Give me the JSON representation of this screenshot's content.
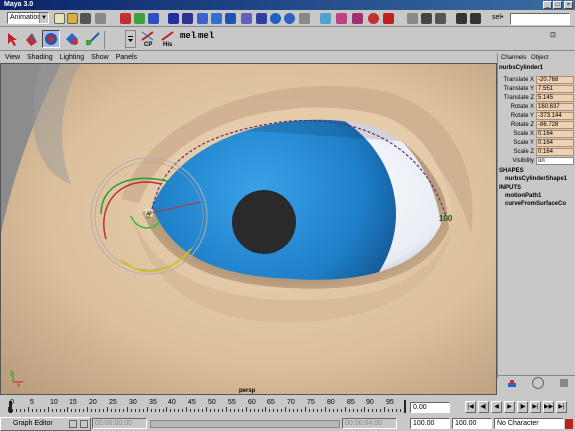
{
  "window": {
    "title": "Maya 3.0"
  },
  "status_line": {
    "menu_set": "Animation",
    "selection_label": "sel•",
    "selection_value": ""
  },
  "shelf": {
    "cp_label": "CP",
    "his_label": "His",
    "mel1": "mel",
    "mel2": "mel"
  },
  "panel_menu": [
    "View",
    "Shading",
    "Lighting",
    "Show",
    "Panels"
  ],
  "viewport": {
    "camera": "persp",
    "curve_start_label": "0",
    "curve_end_label": "100",
    "axis_x": "x",
    "axis_y": "y"
  },
  "channel_box": {
    "tabs": [
      "Channels",
      "Object"
    ],
    "object_name": "nurbsCylinder1",
    "channels": [
      {
        "label": "Translate X",
        "value": "-20.768"
      },
      {
        "label": "Translate Y",
        "value": "7.551"
      },
      {
        "label": "Translate Z",
        "value": "5.145"
      },
      {
        "label": "Rotate X",
        "value": "160.637"
      },
      {
        "label": "Rotate Y",
        "value": "-373.144"
      },
      {
        "label": "Rotate Z",
        "value": "-86.728"
      },
      {
        "label": "Scale X",
        "value": "0.164"
      },
      {
        "label": "Scale Y",
        "value": "0.164"
      },
      {
        "label": "Scale Z",
        "value": "0.164"
      },
      {
        "label": "Visibility",
        "value": "on"
      }
    ],
    "shapes_header": "SHAPES",
    "shape_name": "nurbsCylinderShape1",
    "inputs_header": "INPUTS",
    "inputs": [
      "motionPath1",
      "curveFromSurfaceCo"
    ]
  },
  "timeline": {
    "ticks": [
      "0",
      "5",
      "10",
      "15",
      "20",
      "25",
      "30",
      "35",
      "40",
      "45",
      "50",
      "55",
      "60",
      "65",
      "70",
      "75",
      "80",
      "85",
      "90",
      "95"
    ],
    "current_frame": "0.00"
  },
  "range": {
    "start_time": "00:00:00:00",
    "end_time": "00:00:04:00",
    "start_frame": "100.00",
    "end_frame": "100.00",
    "character": "No Character"
  },
  "taskbar": {
    "graph_editor": "Graph Editor"
  },
  "colors": {
    "iris": "#1e7fc8",
    "pupil": "#2a2a2a",
    "skin": "#e2c9a8",
    "channel_value_bg": "#f0d2b0"
  }
}
